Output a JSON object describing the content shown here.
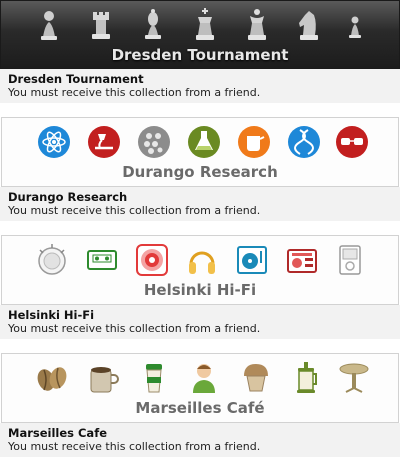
{
  "collections": [
    {
      "banner_title": "Dresden Tournament",
      "name": "Dresden Tournament",
      "description": "You must receive this collection from a friend.",
      "icons": [
        "pawn-icon",
        "rook-icon",
        "bishop-icon",
        "king-icon",
        "queen-icon",
        "knight-icon",
        "pawn-small-icon"
      ]
    },
    {
      "banner_title": "Durango Research",
      "name": "Durango Research",
      "description": "You must receive this collection from a friend.",
      "icons": [
        "atom-icon",
        "microscope-icon",
        "molecule-icon",
        "flask-icon",
        "beaker-icon",
        "dna-icon",
        "goggles-icon"
      ]
    },
    {
      "banner_title": "Helsinki Hi-Fi",
      "name": "Helsinki Hi-Fi",
      "description": "You must receive this collection from a friend.",
      "icons": [
        "knob-icon",
        "cassette-icon",
        "speaker-icon",
        "headphones-icon",
        "turntable-icon",
        "boombox-icon",
        "music-player-icon"
      ]
    },
    {
      "banner_title": "Marseilles Café",
      "name": "Marseilles Cafe",
      "description": "You must receive this collection from a friend.",
      "icons": [
        "coffee-beans-icon",
        "cafe-mug-icon",
        "coffee-cup-icon",
        "barista-icon",
        "muffin-icon",
        "french-press-icon",
        "cafe-table-icon"
      ]
    }
  ]
}
